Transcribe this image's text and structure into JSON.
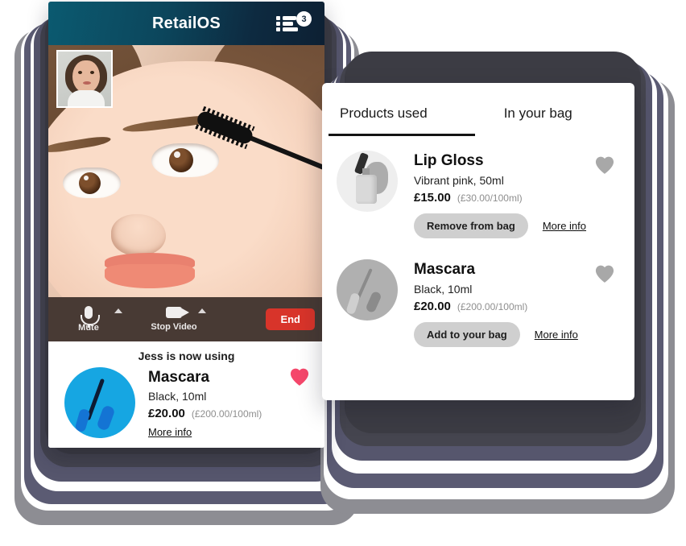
{
  "app": {
    "header": {
      "title": "RetailOS",
      "menu_icon": "list-icon",
      "badge_count": "3"
    }
  },
  "video_call": {
    "self_view_label": "self-view",
    "controls": {
      "mute_label": "Mute",
      "mute_icon": "microphone-icon",
      "video_label": "Stop Video",
      "video_icon": "camera-icon",
      "caret_icon": "chevron-up-icon",
      "end_label": "End"
    }
  },
  "now_using": {
    "heading": "Jess is now using",
    "name": "Mascara",
    "variant": "Black, 10ml",
    "price": "£20.00",
    "unit_price": "(£200.00/100ml)",
    "more_info": "More info",
    "favourited": true,
    "heart_icon": "heart-filled-icon"
  },
  "panel": {
    "tabs": [
      {
        "label": "Products used",
        "active": true
      },
      {
        "label": "In your bag",
        "active": false
      }
    ],
    "products": [
      {
        "name": "Lip Gloss",
        "variant": "Vibrant pink, 50ml",
        "price": "£15.00",
        "unit_price": "(£30.00/100ml)",
        "action_label": "Remove from bag",
        "more_info": "More info",
        "heart_icon": "heart-outline-icon",
        "in_bag": true
      },
      {
        "name": "Mascara",
        "variant": "Black, 10ml",
        "price": "£20.00",
        "unit_price": "(£200.00/100ml)",
        "action_label": "Add to your bag",
        "more_info": "More info",
        "heart_icon": "heart-outline-icon",
        "in_bag": false
      }
    ]
  },
  "colors": {
    "header_gradient_start": "#0b5a70",
    "header_gradient_end": "#0d2033",
    "end_button": "#d8342a",
    "heart_active": "#f5476b",
    "heart_inactive": "#a8a8a8",
    "thumb_accent": "#16a6e2",
    "button_grey": "#cfcfcf",
    "shadow_stack": "#5a5a72"
  }
}
